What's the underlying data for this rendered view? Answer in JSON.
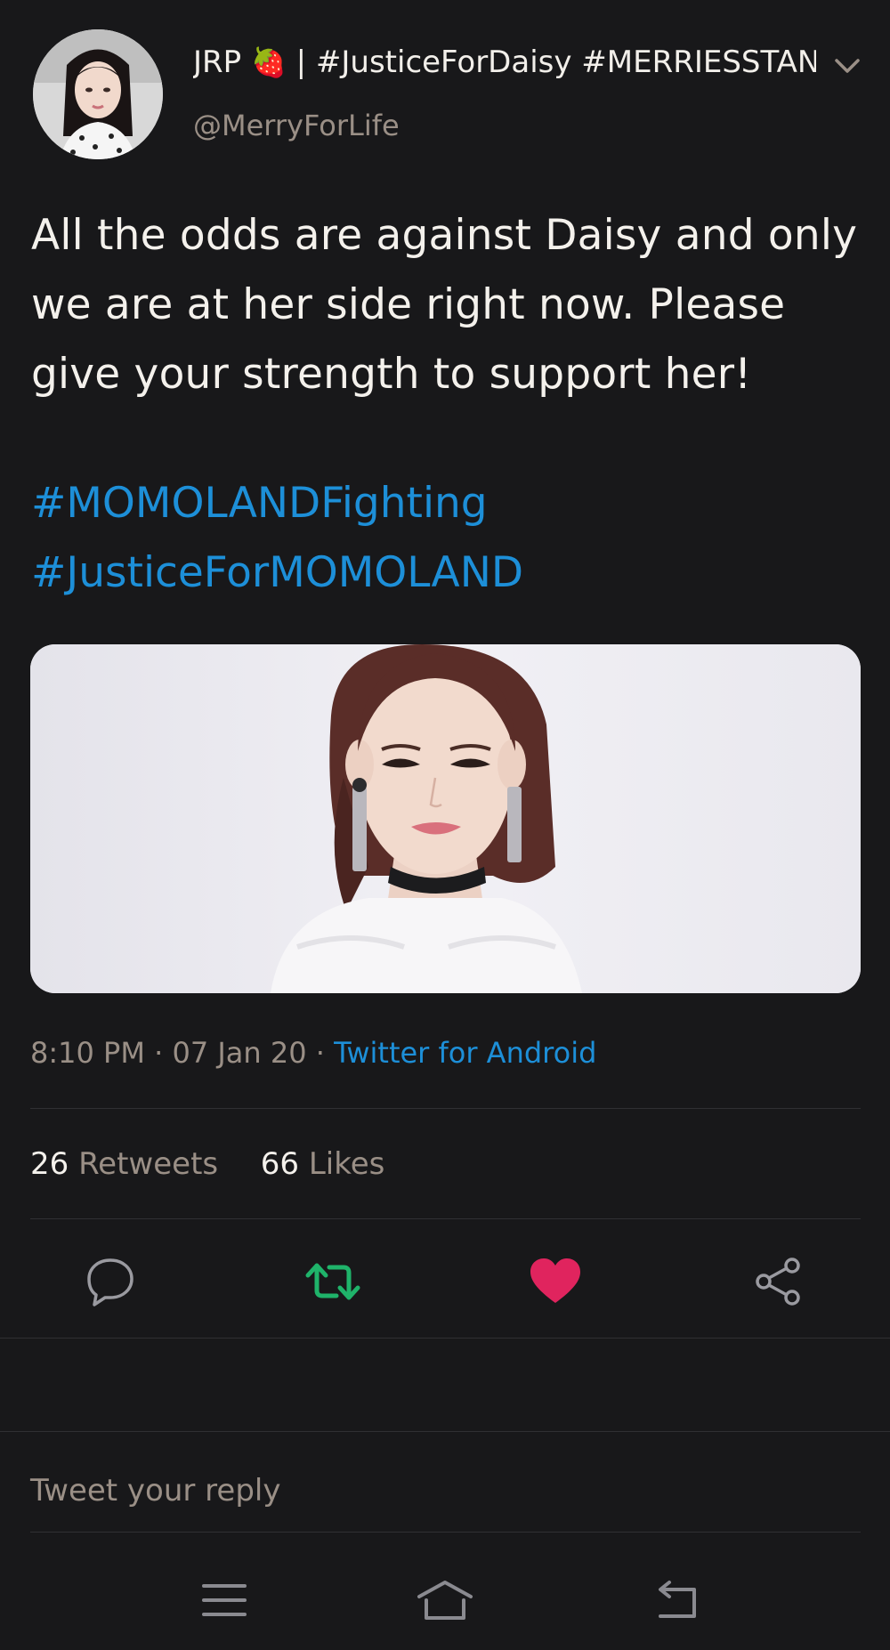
{
  "author": {
    "display_name": "JRP",
    "emoji": "🍓",
    "display_suffix": "| #JusticeForDaisy #MERRIESSTAN...",
    "handle": "@MerryForLife"
  },
  "tweet": {
    "text": "All the odds are against Daisy and only we are at her side right now. Please give your strength to support her!",
    "hashtags": [
      "#MOMOLANDFighting",
      "#JusticeForMOMOLAND"
    ]
  },
  "meta": {
    "time": "8:10 PM",
    "sep1": "·",
    "date": "07 Jan 20",
    "sep2": "·",
    "client": "Twitter for Android"
  },
  "stats": {
    "retweets_count": "26",
    "retweets_label": "Retweets",
    "likes_count": "66",
    "likes_label": "Likes"
  },
  "actions": {
    "reply_icon": "reply-icon",
    "retweet_icon": "retweet-icon",
    "like_icon": "heart-icon",
    "share_icon": "share-icon",
    "retweet_color": "#1fb36a",
    "like_color": "#e0245e"
  },
  "reply": {
    "placeholder": "Tweet your reply"
  },
  "colors": {
    "background": "#18181a",
    "link": "#1d8fd8",
    "muted": "#9a8f86"
  }
}
